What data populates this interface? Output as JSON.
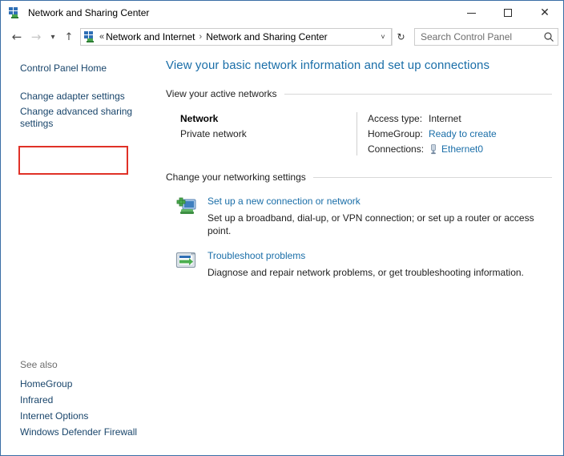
{
  "window": {
    "title": "Network and Sharing Center",
    "icon": "network-icon",
    "controls": {
      "minimize": "minimize-button",
      "maximize": "maximize-button",
      "close": "close-button"
    }
  },
  "navbar": {
    "back": "back-arrow-icon",
    "forward": "forward-arrow-icon",
    "recent": "recent-locations-chevron-icon",
    "up": "up-arrow-icon",
    "address_icon": "network-icon",
    "chevrons": "«",
    "breadcrumbs": [
      {
        "label": "Network and Internet"
      },
      {
        "label": "Network and Sharing Center"
      }
    ],
    "separator": "›",
    "dropdown": "˅",
    "refresh": "↻",
    "search": {
      "placeholder": "Search Control Panel",
      "value": "",
      "icon": "search-icon"
    }
  },
  "sidebar": {
    "items": [
      {
        "label": "Control Panel Home",
        "highlighted": false
      },
      {
        "label": "Change adapter settings",
        "highlighted": false
      },
      {
        "label": "Change advanced sharing settings",
        "highlighted": true
      }
    ],
    "see_also": {
      "title": "See also",
      "items": [
        {
          "label": "HomeGroup"
        },
        {
          "label": "Infrared"
        },
        {
          "label": "Internet Options"
        },
        {
          "label": "Windows Defender Firewall"
        }
      ]
    }
  },
  "main": {
    "heading": "View your basic network information and set up connections",
    "active_networks": {
      "section_title": "View your active networks",
      "network": {
        "name": "Network",
        "type": "Private network",
        "details": [
          {
            "label": "Access type:",
            "value": "Internet",
            "is_link": false,
            "icon": ""
          },
          {
            "label": "HomeGroup:",
            "value": "Ready to create",
            "is_link": true,
            "icon": ""
          },
          {
            "label": "Connections:",
            "value": "Ethernet0",
            "is_link": true,
            "icon": "ethernet-icon"
          }
        ]
      }
    },
    "networking_settings": {
      "section_title": "Change your networking settings",
      "tasks": [
        {
          "link": "Set up a new connection or network",
          "description": "Set up a broadband, dial-up, or VPN connection; or set up a router or access point.",
          "icon": "new-connection-icon"
        },
        {
          "link": "Troubleshoot problems",
          "description": "Diagnose and repair network problems, or get troubleshooting information.",
          "icon": "troubleshoot-icon"
        }
      ]
    }
  },
  "colors": {
    "window_border": "#3a6ea5",
    "heading_blue": "#1a6ea8",
    "link_blue": "#1a6ea8",
    "sidebar_link": "#19456b",
    "highlight_red": "#e03127",
    "muted_gray": "#6d6d6d"
  }
}
